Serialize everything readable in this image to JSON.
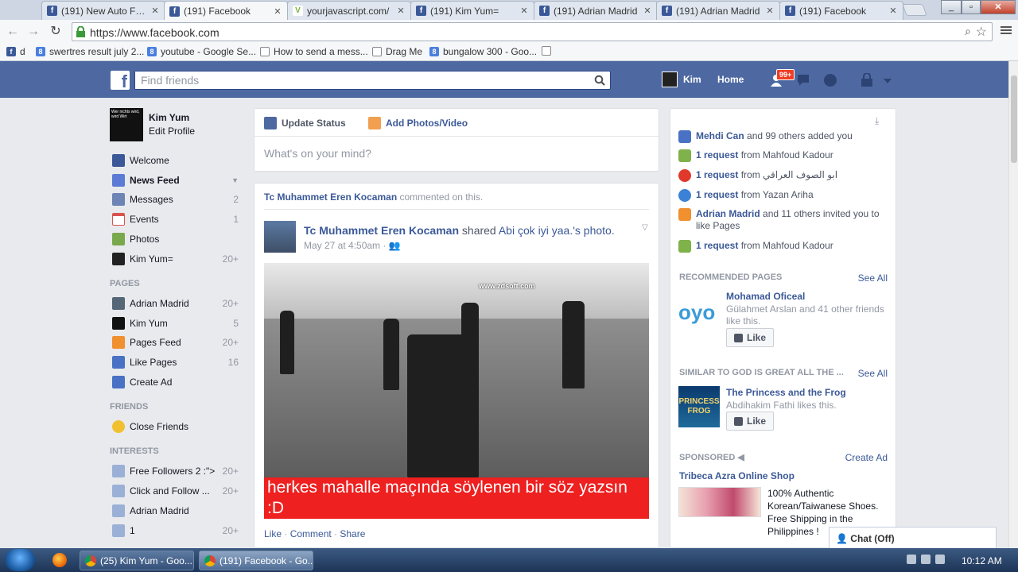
{
  "browser": {
    "tabs": [
      {
        "label": "(191) New Auto Follo",
        "icon": "facebook-icon"
      },
      {
        "label": "(191) Facebook",
        "icon": "facebook-icon",
        "active": true
      },
      {
        "label": "yourjavascript.com/",
        "icon": "v-icon"
      },
      {
        "label": "(191) Kim Yum=",
        "icon": "facebook-icon"
      },
      {
        "label": "(191) Adrian Madrid",
        "icon": "facebook-icon"
      },
      {
        "label": "(191) Adrian Madrid",
        "icon": "facebook-icon"
      },
      {
        "label": "(191) Facebook",
        "icon": "facebook-icon"
      }
    ],
    "url": "https://www.facebook.com",
    "bookmarks": [
      {
        "label": "d",
        "icon": "facebook"
      },
      {
        "label": "swertres result july 2...",
        "icon": "google"
      },
      {
        "label": "youtube - Google Se...",
        "icon": "google"
      },
      {
        "label": "How to send a mess...",
        "icon": "doc"
      },
      {
        "label": "Drag Me",
        "icon": "doc"
      },
      {
        "label": "bungalow 300 - Goo...",
        "icon": "google"
      },
      {
        "label": "",
        "icon": "doc"
      }
    ]
  },
  "fb": {
    "logo": "f",
    "search_placeholder": "Find friends",
    "user_name": "Kim",
    "home_label": "Home",
    "friend_requests_badge": "99+"
  },
  "left": {
    "profile_name": "Kim Yum",
    "edit_profile": "Edit Profile",
    "profile_pic_text": "Wer nichts wird, wird Wirt",
    "items": [
      {
        "label": "Welcome",
        "count": "",
        "icon_color": "#3b5998"
      },
      {
        "label": "News Feed",
        "count": "",
        "icon_color": "#5b7bd5"
      },
      {
        "label": "Messages",
        "count": "2",
        "icon_color": "#6d84b4"
      },
      {
        "label": "Events",
        "count": "1",
        "icon_color": "#d9534f"
      },
      {
        "label": "Photos",
        "count": "",
        "icon_color": "#7aa84c"
      },
      {
        "label": "Kim Yum=",
        "count": "20+",
        "icon_color": "#222222"
      }
    ],
    "pages_header": "PAGES",
    "pages": [
      {
        "label": "Adrian Madrid",
        "count": "20+",
        "icon_color": "#556677"
      },
      {
        "label": "Kim Yum",
        "count": "5",
        "icon_color": "#111111"
      },
      {
        "label": "Pages Feed",
        "count": "20+",
        "icon_color": "#f0902f"
      },
      {
        "label": "Like Pages",
        "count": "16",
        "icon_color": "#4a72c4"
      },
      {
        "label": "Create Ad",
        "count": "",
        "icon_color": "#4a72c4"
      }
    ],
    "friends_header": "FRIENDS",
    "friends": [
      {
        "label": "Close Friends",
        "count": "",
        "icon_color": "#f0c030"
      }
    ],
    "interests_header": "INTERESTS",
    "interests": [
      {
        "label": "Free Followers 2 :\">",
        "count": "20+",
        "icon_color": "#9bb0d6"
      },
      {
        "label": "Click and Follow ...",
        "count": "20+",
        "icon_color": "#9bb0d6"
      },
      {
        "label": "Adrian Madrid",
        "count": "",
        "icon_color": "#9bb0d6"
      },
      {
        "label": "1",
        "count": "20+",
        "icon_color": "#9bb0d6"
      }
    ]
  },
  "composer": {
    "update_status": "Update Status",
    "add_photos": "Add Photos/Video",
    "placeholder": "What's on your mind?"
  },
  "story": {
    "context_name": "Tc Muhammet Eren Kocaman",
    "context_text": "commented on this.",
    "author": "Tc Muhammet Eren Kocaman",
    "verb": "shared",
    "shared_link": "Abi çok iyi yaa.'s photo.",
    "time": "May 27 at 4:50am",
    "watermark": "www.zdsoft.com",
    "caption": "herkes mahalle maçında söylenen bir söz yazsın :D",
    "like": "Like",
    "comment": "Comment",
    "share": "Share"
  },
  "right": {
    "notifications": [
      {
        "bold": "Mehdi Can",
        "rest": "and 99 others added you",
        "icon_color": "#4a72c4"
      },
      {
        "bold": "1 request",
        "rest": "from Mahfoud Kadour",
        "icon_color": "#7fb24a"
      },
      {
        "bold": "1 request",
        "rest": "from ابو الصوف العراقي",
        "icon_color": "#e0392b"
      },
      {
        "bold": "1 request",
        "rest": "from Yazan Ariha",
        "icon_color": "#3b82d6"
      },
      {
        "bold": "Adrian Madrid",
        "rest": "and 11 others invited you to like Pages",
        "icon_color": "#f0902f"
      },
      {
        "bold": "1 request",
        "rest": "from Mahfoud Kadour",
        "icon_color": "#7fb24a"
      }
    ],
    "recommended_header": "RECOMMENDED PAGES",
    "see_all": "See All",
    "rec_title": "Mohamad Oficeal",
    "rec_sub": "Gülahmet Arslan and 41 other friends like this.",
    "rec_thumb_text": "oyo",
    "like_label": "Like",
    "similar_header": "SIMILAR TO GOD IS GREAT ALL THE ...",
    "sim_title": "The Princess and the Frog",
    "sim_sub": "Abdihakim Fathi likes this.",
    "sim_thumb_text": "PRINCESS FROG",
    "sponsored_header": "SPONSORED",
    "create_ad": "Create Ad",
    "ad_title": "Tribeca Azra Online Shop",
    "ad_text": "100% Authentic Korean/Taiwanese Shoes. Free Shipping in the Philippines !"
  },
  "chat_label": "Chat (Off)",
  "taskbar": {
    "tasks": [
      "(25) Kim Yum - Goo...",
      "(191) Facebook - Go..."
    ],
    "clock": "10:12 AM"
  }
}
